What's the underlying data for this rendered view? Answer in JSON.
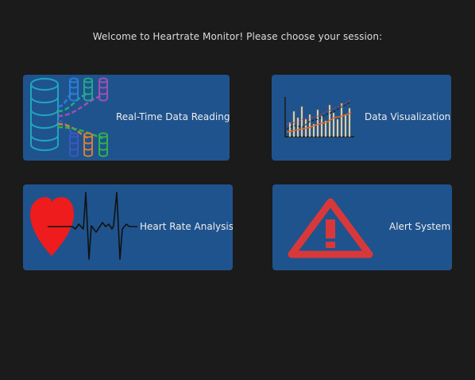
{
  "header": {
    "welcome_text": "Welcome to Heartrate Monitor! Please choose your session:"
  },
  "sessions": [
    {
      "label": "Real-Time Data Reading",
      "icon": "database-streams-icon"
    },
    {
      "label": "Data Visualization",
      "icon": "chart-icon"
    },
    {
      "label": "Heart Rate Analysis",
      "icon": "heart-ecg-icon"
    },
    {
      "label": "Alert System",
      "icon": "warning-triangle-icon"
    }
  ],
  "colors": {
    "background": "#1b1b1b",
    "tile": "#1f538d",
    "text": "#ececec",
    "alert_red": "#d9383a",
    "heart_red": "#ee1c1c"
  }
}
